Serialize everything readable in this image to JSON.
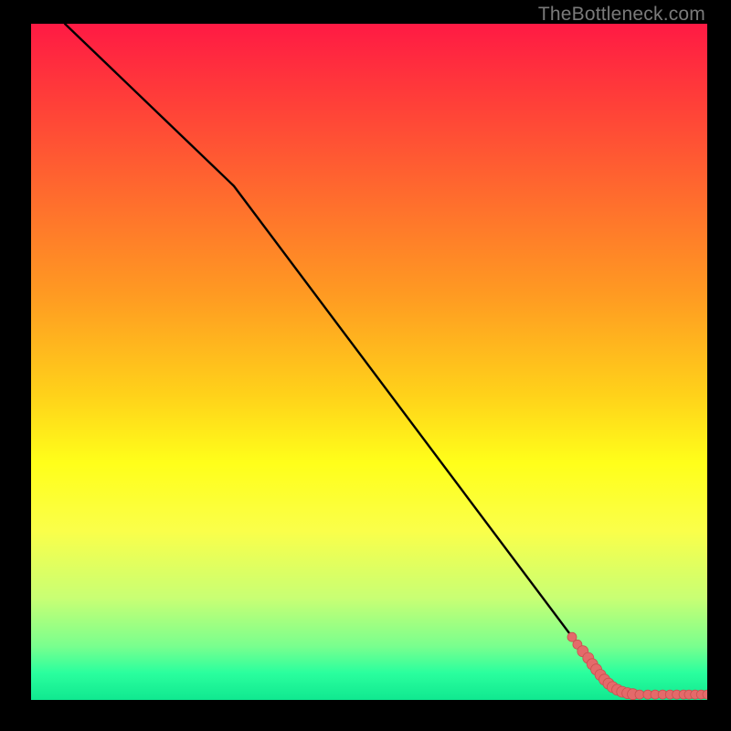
{
  "attribution": "TheBottleneck.com",
  "colors": {
    "line": "#000000",
    "marker_fill": "#e46a6a",
    "marker_stroke": "#c94f4f"
  },
  "chart_data": {
    "type": "line",
    "title": "",
    "xlabel": "",
    "ylabel": "",
    "xlim": [
      0,
      100
    ],
    "ylim": [
      0,
      100
    ],
    "grid": false,
    "series": [
      {
        "name": "curve",
        "x": [
          5,
          30,
          84,
          88,
          100
        ],
        "y": [
          100,
          76,
          4,
          0.8,
          0.8
        ]
      }
    ],
    "markers": {
      "name": "points",
      "x": [
        80.0,
        80.8,
        81.6,
        82.4,
        83.0,
        83.6,
        84.2,
        84.8,
        85.4,
        86.0,
        86.7,
        87.4,
        88.2,
        89.0,
        90.0,
        91.2,
        92.3,
        93.4,
        94.5,
        95.5,
        96.5,
        97.3,
        98.2,
        99.1,
        100.0
      ],
      "y": [
        9.3,
        8.2,
        7.2,
        6.2,
        5.3,
        4.5,
        3.7,
        3.0,
        2.4,
        1.9,
        1.5,
        1.2,
        1.0,
        0.85,
        0.8,
        0.8,
        0.8,
        0.8,
        0.8,
        0.8,
        0.8,
        0.8,
        0.8,
        0.8,
        0.8
      ],
      "r": [
        5,
        5,
        6,
        6,
        6,
        6,
        6,
        6,
        6,
        6,
        6,
        6,
        6,
        6,
        5,
        5,
        5,
        5,
        5,
        5,
        5,
        5,
        5,
        5,
        5
      ]
    }
  }
}
